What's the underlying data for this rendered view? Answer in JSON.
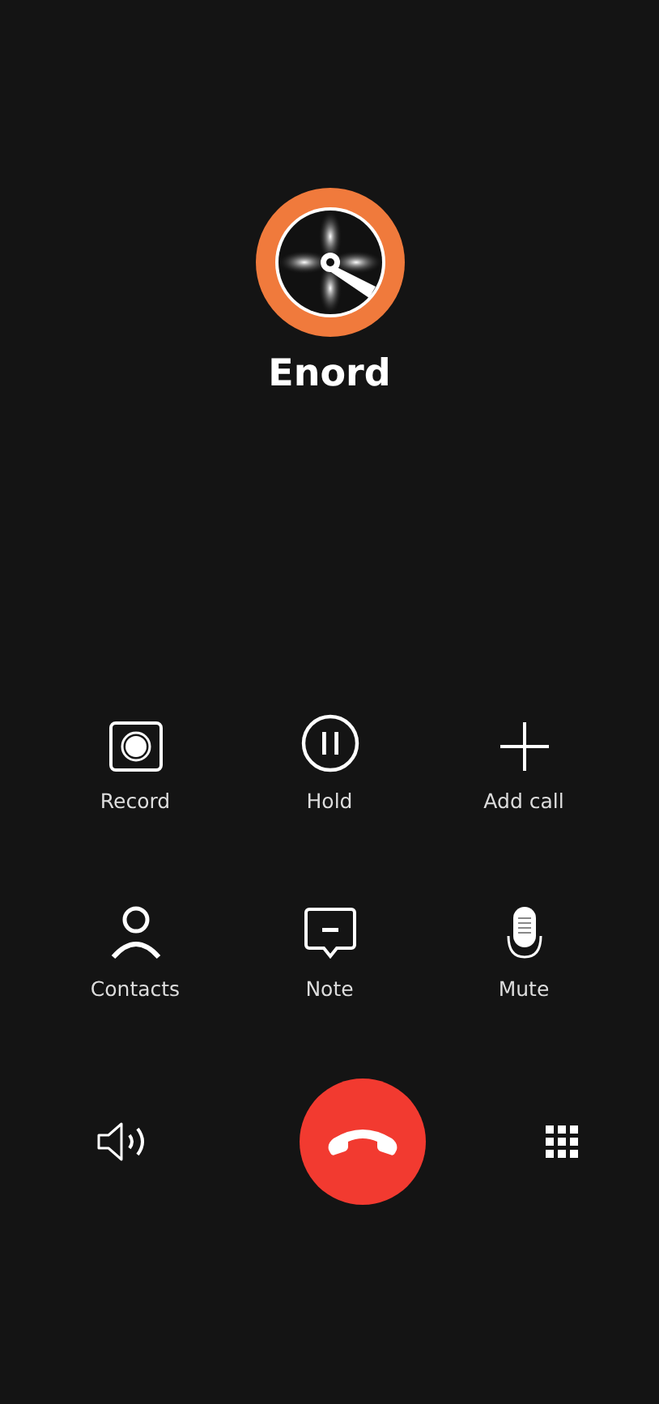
{
  "caller": {
    "name": "Enord"
  },
  "actions": [
    {
      "kind": "record",
      "label": "Record"
    },
    {
      "kind": "hold",
      "label": "Hold"
    },
    {
      "kind": "add",
      "label": "Add call"
    },
    {
      "kind": "contacts",
      "label": "Contacts"
    },
    {
      "kind": "note",
      "label": "Note"
    },
    {
      "kind": "mute",
      "label": "Mute"
    }
  ],
  "bottom": [
    {
      "kind": "speaker"
    },
    {
      "kind": "end"
    },
    {
      "kind": "keypad"
    }
  ]
}
